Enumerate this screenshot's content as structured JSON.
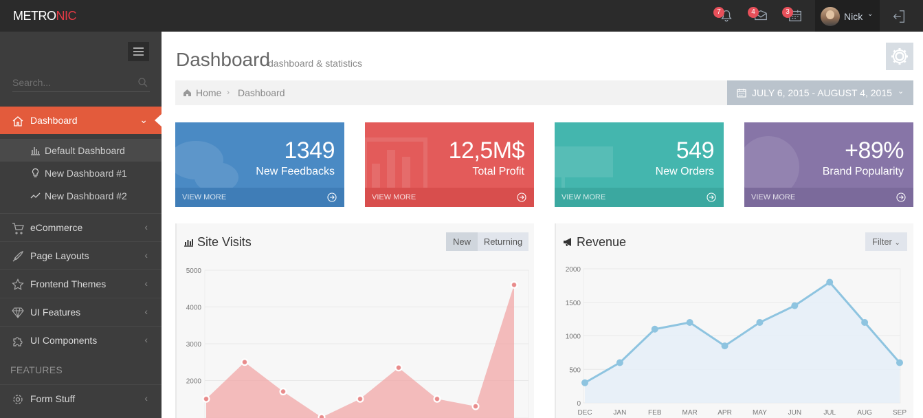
{
  "app": {
    "logo_main": "METRO",
    "logo_accent": "NIC"
  },
  "topbar": {
    "notifications": {
      "count": "7",
      "icon": "bell-icon"
    },
    "inbox": {
      "count": "4",
      "icon": "envelope-icon"
    },
    "tasks": {
      "count": "3",
      "icon": "calendar-icon"
    },
    "user_name": "Nick",
    "logout_icon": "logout-icon"
  },
  "sidebar": {
    "search_placeholder": "Search...",
    "items": [
      {
        "label": "Dashboard",
        "icon": "home-icon"
      },
      {
        "label": "eCommerce",
        "icon": "cart-icon"
      },
      {
        "label": "Page Layouts",
        "icon": "rocket-icon"
      },
      {
        "label": "Frontend Themes",
        "icon": "star-icon"
      },
      {
        "label": "UI Features",
        "icon": "diamond-icon"
      },
      {
        "label": "UI Components",
        "icon": "puzzle-icon"
      }
    ],
    "subitems": [
      {
        "label": "Default Dashboard",
        "icon": "bar-chart-icon"
      },
      {
        "label": "New Dashboard #1",
        "icon": "bulb-icon"
      },
      {
        "label": "New Dashboard #2",
        "icon": "graph-icon"
      }
    ],
    "heading_features": "FEATURES",
    "form_item": {
      "label": "Form Stuff",
      "icon": "settings-icon"
    }
  },
  "page": {
    "title": "Dashboard",
    "subtitle": "dashboard & statistics",
    "breadcrumb": {
      "home": "Home",
      "current": "Dashboard"
    },
    "date_range": "JULY 6, 2015 - AUGUST 4, 2015"
  },
  "stats": [
    {
      "number": "1349",
      "label": "New Feedbacks",
      "more": "VIEW MORE",
      "color": "#4a8ac4"
    },
    {
      "number": "12,5M$",
      "label": "Total Profit",
      "more": "VIEW MORE",
      "color": "#e35b5a"
    },
    {
      "number": "549",
      "label": "New Orders",
      "more": "VIEW MORE",
      "color": "#44b6ae"
    },
    {
      "number": "+89%",
      "label": "Brand Popularity",
      "more": "VIEW MORE",
      "color": "#8775a7"
    }
  ],
  "site_visits": {
    "title": "Site Visits",
    "tab_new": "New",
    "tab_returning": "Returning"
  },
  "revenue": {
    "title": "Revenue",
    "filter": "Filter"
  },
  "chart_data": [
    {
      "type": "area",
      "title": "Site Visits",
      "yticks": [
        5000,
        4000,
        3000,
        2000
      ],
      "ylim": [
        1000,
        5000
      ],
      "values": [
        1500,
        2500,
        1700,
        1000,
        1500,
        2350,
        1500,
        1300,
        4600
      ],
      "color": "#f2a7a7"
    },
    {
      "type": "line",
      "title": "Revenue",
      "categories": [
        "DEC",
        "JAN",
        "FEB",
        "MAR",
        "APR",
        "MAY",
        "JUN",
        "JUL",
        "AUG",
        "SEP"
      ],
      "values": [
        300,
        600,
        1100,
        1200,
        850,
        1200,
        1450,
        1800,
        1200,
        600
      ],
      "yticks": [
        2000,
        1500,
        1000,
        500,
        0
      ],
      "ylim": [
        0,
        2000
      ],
      "color": "#8ec4e0"
    }
  ]
}
